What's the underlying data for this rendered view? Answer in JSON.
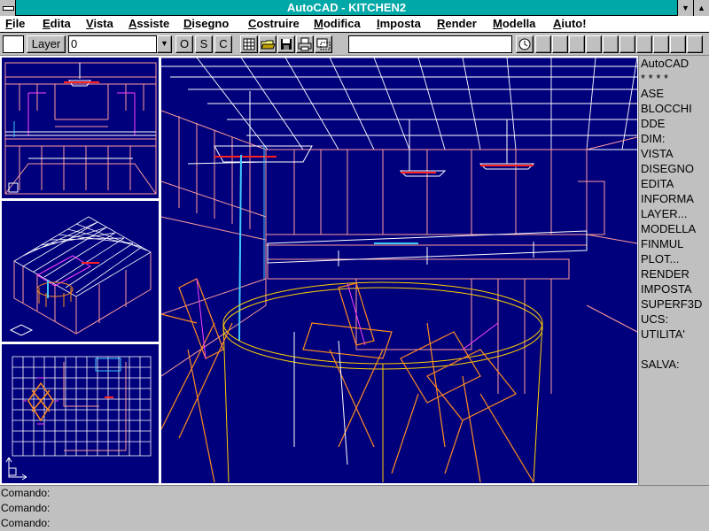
{
  "window": {
    "title": "AutoCAD - KITCHEN2",
    "minimize_glyph": "▼",
    "maximize_glyph": "▲"
  },
  "menu": [
    {
      "label": "File",
      "mnemonic": "F",
      "rest": "ile"
    },
    {
      "label": "Edita",
      "mnemonic": "E",
      "rest": "dita"
    },
    {
      "label": "Vista",
      "mnemonic": "V",
      "rest": "ista"
    },
    {
      "label": "Assiste",
      "mnemonic": "A",
      "rest": "ssiste"
    },
    {
      "label": "Disegno",
      "mnemonic": "D",
      "rest": "isegno"
    },
    {
      "label": "Costruire",
      "mnemonic": "C",
      "rest": "ostruire"
    },
    {
      "label": "Modifica",
      "mnemonic": "M",
      "rest": "odifica"
    },
    {
      "label": "Imposta",
      "mnemonic": "I",
      "rest": "mposta"
    },
    {
      "label": "Render",
      "mnemonic": "R",
      "rest": "ender"
    },
    {
      "label": "Modella",
      "mnemonic": "M",
      "rest": "odella"
    },
    {
      "label": "Aiuto!",
      "mnemonic": "A",
      "rest": "iuto!"
    }
  ],
  "toolbar": {
    "layer_button": "Layer",
    "layer_value": "0",
    "dropdown_glyph": "▼",
    "ortho": "O",
    "snap": "S",
    "grid": "C",
    "icons": [
      "grid-icon",
      "open-folder-icon",
      "save-disk-icon",
      "print-icon",
      "zoom-window-icon"
    ],
    "clock_icon": "clock-icon",
    "blank_button_count": 10
  },
  "screen_menu": [
    "AutoCAD",
    "* * * *",
    "ASE",
    "BLOCCHI",
    "DDE",
    "DIM:",
    "VISTA",
    "DISEGNO",
    "EDITA",
    "INFORMA",
    "LAYER...",
    "MODELLA",
    "FINMUL",
    "PLOT...",
    "RENDER",
    "IMPOSTA",
    "SUPERF3D",
    "UCS:",
    "UTILITA'",
    "",
    "SALVA:"
  ],
  "command_lines": [
    "Comando:",
    "Comando:",
    "Comando:"
  ],
  "viewports": [
    {
      "name": "front-elevation-viewport",
      "view": "front"
    },
    {
      "name": "isometric-viewport",
      "view": "isometric"
    },
    {
      "name": "plan-viewport",
      "view": "plan"
    },
    {
      "name": "perspective-viewport",
      "view": "perspective"
    }
  ],
  "colors": {
    "title_bar": "#00a8a8",
    "viewport_bg": "#00007c",
    "wire_white": "#ffffff",
    "wire_pink": "#ff9c9c",
    "wire_magenta": "#ff40ff",
    "wire_orange": "#ff8c20",
    "wire_yellow": "#ffd000",
    "wire_cyan": "#40c8ff",
    "wire_red": "#ff2020"
  }
}
